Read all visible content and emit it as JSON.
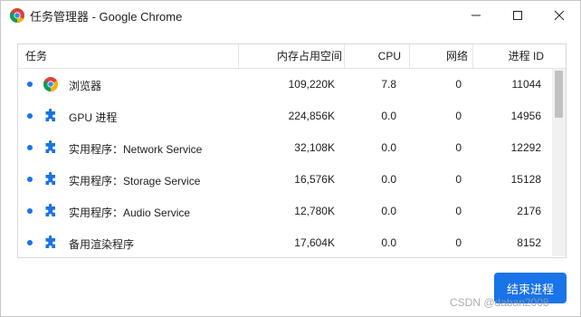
{
  "window": {
    "title": "任务管理器 - Google Chrome"
  },
  "table": {
    "headers": {
      "task": "任务",
      "memory": "内存占用空间",
      "cpu": "CPU",
      "network": "网络",
      "pid": "进程 ID"
    },
    "rows": [
      {
        "icon": "chrome-icon",
        "name": "浏览器",
        "memory": "109,220K",
        "cpu": "7.8",
        "network": "0",
        "pid": "11044"
      },
      {
        "icon": "puzzle-piece-icon",
        "name": "GPU 进程",
        "memory": "224,856K",
        "cpu": "0.0",
        "network": "0",
        "pid": "14956"
      },
      {
        "icon": "puzzle-piece-icon",
        "name": "实用程序：Network Service",
        "memory": "32,108K",
        "cpu": "0.0",
        "network": "0",
        "pid": "12292"
      },
      {
        "icon": "puzzle-piece-icon",
        "name": "实用程序：Storage Service",
        "memory": "16,576K",
        "cpu": "0.0",
        "network": "0",
        "pid": "15128"
      },
      {
        "icon": "puzzle-piece-icon",
        "name": "实用程序：Audio Service",
        "memory": "12,780K",
        "cpu": "0.0",
        "network": "0",
        "pid": "2176"
      },
      {
        "icon": "puzzle-piece-icon",
        "name": "备用渲染程序",
        "memory": "17,604K",
        "cpu": "0.0",
        "network": "0",
        "pid": "8152"
      }
    ]
  },
  "actions": {
    "end_process_label": "结束进程"
  },
  "watermark": "CSDN @daban2008",
  "colors": {
    "accent": "#1a73e8",
    "bullet": "#1a73e8"
  }
}
